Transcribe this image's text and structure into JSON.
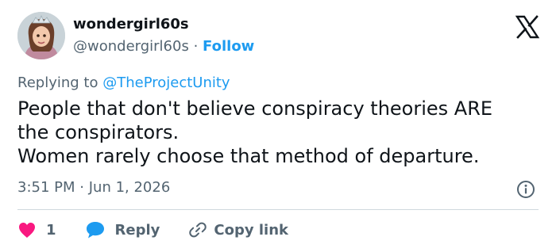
{
  "author": {
    "display_name": "wondergirl60s",
    "handle": "@wondergirl60s",
    "separator": "·",
    "follow_label": "Follow"
  },
  "reply_context": {
    "prefix": "Replying to",
    "mention": "@TheProjectUnity"
  },
  "tweet": {
    "lines": [
      "People that don't believe conspiracy theories ARE",
      "the conspirators.",
      "Women rarely choose that method of departure."
    ],
    "time": "3:51 PM",
    "date_separator": "·",
    "date": "Jun 1, 2026"
  },
  "actions": {
    "like_count": "1",
    "reply_label": "Reply",
    "copy_link_label": "Copy link"
  },
  "icons": {
    "platform_logo": "x-logo-icon",
    "info": "info-icon",
    "like": "heart-icon",
    "reply": "speech-bubble-icon",
    "copy_link": "link-icon"
  },
  "colors": {
    "link_blue": "#1d9bf0",
    "secondary_text": "#536471",
    "like_red": "#f91880",
    "primary_text": "#0f1419"
  }
}
